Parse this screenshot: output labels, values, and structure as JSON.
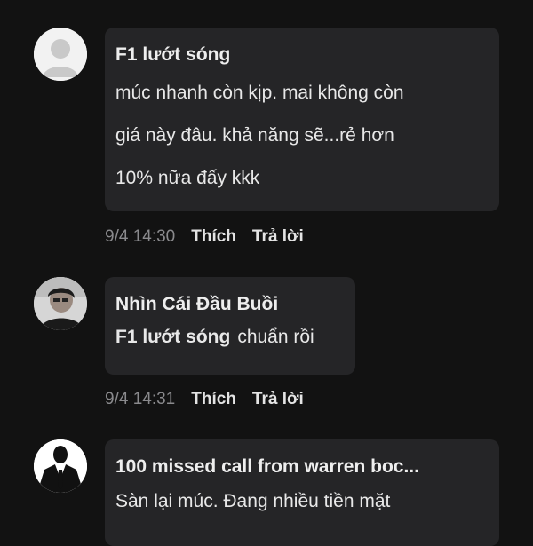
{
  "comments": [
    {
      "author": "F1 lướt sóng",
      "lines": [
        "múc nhanh còn kịp. mai không còn",
        "giá này đâu. khả năng sẽ...rẻ hơn",
        "10% nữa đấy kkk"
      ],
      "time": "9/4 14:30",
      "like_label": "Thích",
      "reply_label": "Trả lời",
      "avatar_icon": "default-user-avatar"
    },
    {
      "author": "Nhìn Cái Đầu Buồi",
      "mention": "F1 lướt sóng",
      "text": "chuẩn rồi",
      "time": "9/4 14:31",
      "like_label": "Thích",
      "reply_label": "Trả lời",
      "avatar_icon": "person-photo-avatar"
    },
    {
      "author": "100 missed call from warren boc...",
      "text": "Sàn lại múc. Đang nhiều tiền mặt",
      "avatar_icon": "suit-figure-avatar"
    }
  ],
  "colors": {
    "background": "#121212",
    "bubble": "#252527",
    "timestamp": "#8a8a8d"
  }
}
